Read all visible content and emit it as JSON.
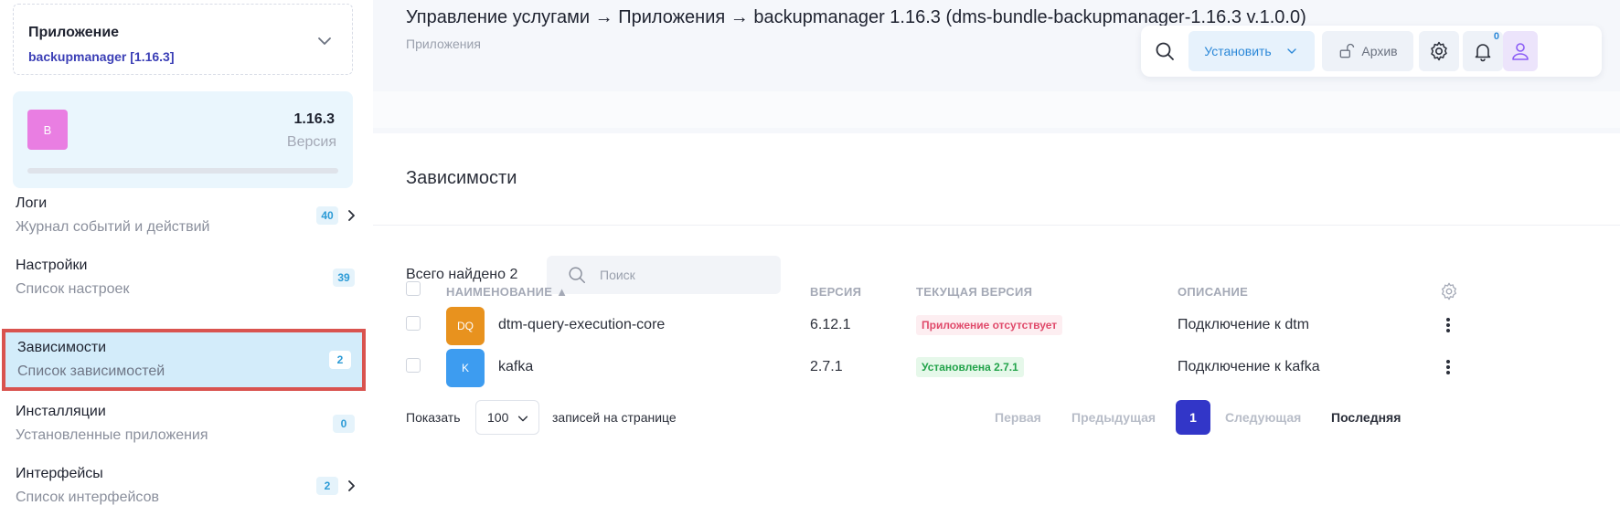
{
  "sidebar": {
    "app_select": {
      "label": "Приложение",
      "value": "backupmanager [1.16.3]"
    },
    "version_card": {
      "avatar": "B",
      "version": "1.16.3",
      "version_label": "Версия",
      "avatar_color": "#e97ee2"
    },
    "items": [
      {
        "title": "Логи",
        "subtitle": "Журнал событий и действий",
        "badge": "40"
      },
      {
        "title": "Настройки",
        "subtitle": "Список настроек",
        "badge": "39"
      },
      {
        "title": "Зависимости",
        "subtitle": "Список зависимостей",
        "badge": "2"
      },
      {
        "title": "Инсталляции",
        "subtitle": "Установленные приложения",
        "badge": "0"
      },
      {
        "title": "Интерфейсы",
        "subtitle": "Список интерфейсов",
        "badge": "2"
      }
    ]
  },
  "header": {
    "breadcrumb": "Управление услугами → Приложения → backupmanager 1.16.3 (dms-bundle-backupmanager-1.16.3 v.1.0.0)",
    "subtitle": "Приложения"
  },
  "toolbar": {
    "install_label": "Установить",
    "archive_label": "Архив",
    "notifications_count": "0",
    "accent_color": "#2b88d8"
  },
  "panel": {
    "title": "Зависимости",
    "total_label": "Всего найдено 2",
    "search_placeholder": "Поиск"
  },
  "table": {
    "columns": {
      "name": "НАИМЕНОВАНИЕ ▲",
      "version": "ВЕРСИЯ",
      "current": "ТЕКУЩАЯ ВЕРСИЯ",
      "description": "ОПИСАНИЕ"
    },
    "rows": [
      {
        "icon": "DQ",
        "icon_color": "#e8921e",
        "name": "dtm-query-execution-core",
        "version": "6.12.1",
        "current": "Приложение отсутствует",
        "current_status": "missing",
        "description": "Подключение к dtm"
      },
      {
        "icon": "K",
        "icon_color": "#3d9cf0",
        "name": "kafka",
        "version": "2.7.1",
        "current": "Установлена 2.7.1",
        "current_status": "installed",
        "description": "Подключение к kafka"
      }
    ]
  },
  "pagination": {
    "show_label": "Показать",
    "per_page": "100",
    "per_page_label": "записей на странице",
    "first": "Первая",
    "prev": "Предыдущая",
    "current": "1",
    "next": "Следующая",
    "last": "Последняя",
    "current_color": "#3236c8"
  }
}
